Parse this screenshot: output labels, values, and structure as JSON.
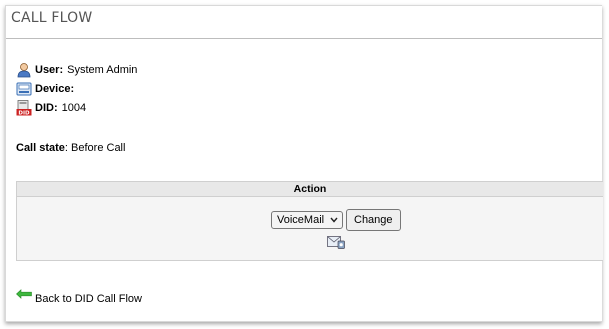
{
  "header": {
    "title": "CALL FLOW"
  },
  "info": {
    "user": {
      "label": "User:",
      "value": "System Admin"
    },
    "device": {
      "label": "Device:",
      "value": ""
    },
    "did": {
      "label": "DID:",
      "value": "1004"
    }
  },
  "call_state": {
    "label": "Call state",
    "value": ": Before Call"
  },
  "action": {
    "header": "Action",
    "selected_option": "VoiceMail",
    "change_label": "Change"
  },
  "back_link": {
    "label": "Back to DID Call Flow"
  },
  "colors": {
    "accent_red": "#cc2222",
    "link_green": "#2a9a2a",
    "icon_blue": "#3a6fb5"
  }
}
